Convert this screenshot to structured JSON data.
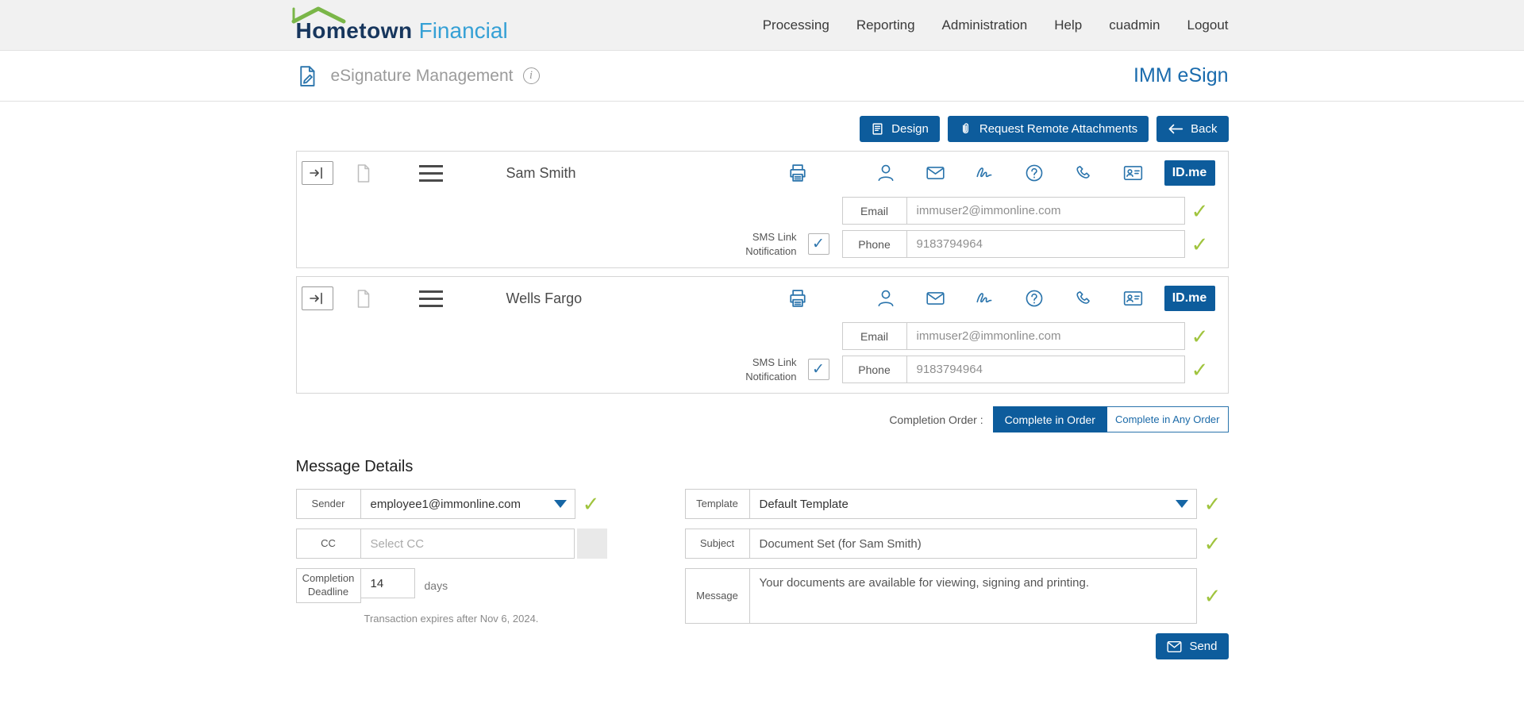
{
  "header": {
    "logo": {
      "name": "Hometown",
      "suffix": "Financial"
    },
    "nav": [
      "Processing",
      "Reporting",
      "Administration",
      "Help",
      "cuadmin",
      "Logout"
    ]
  },
  "subheader": {
    "title": "eSignature Management",
    "brand": "IMM eSign"
  },
  "toolbar": {
    "design": "Design",
    "request_remote": "Request Remote Attachments",
    "back": "Back"
  },
  "signers": [
    {
      "name": "Sam Smith",
      "email_label": "Email",
      "email": "immuser2@immonline.com",
      "sms_label": "SMS Link Notification",
      "phone_label": "Phone",
      "phone": "9183794964",
      "idme": "ID.me"
    },
    {
      "name": "Wells Fargo",
      "email_label": "Email",
      "email": "immuser2@immonline.com",
      "sms_label": "SMS Link Notification",
      "phone_label": "Phone",
      "phone": "9183794964",
      "idme": "ID.me"
    }
  ],
  "completion_order": {
    "label": "Completion Order :",
    "in_order": "Complete in Order",
    "any_order": "Complete in Any Order"
  },
  "message_details": {
    "title": "Message Details",
    "sender_label": "Sender",
    "sender_value": "employee1@immonline.com",
    "cc_label": "CC",
    "cc_placeholder": "Select CC",
    "deadline_label": "Completion Deadline",
    "deadline_value": "14",
    "deadline_units": "days",
    "expires_note": "Transaction expires after Nov 6, 2024.",
    "template_label": "Template",
    "template_value": "Default Template",
    "subject_label": "Subject",
    "subject_value": "Document Set (for Sam Smith)",
    "message_label": "Message",
    "message_value": "Your documents are available for viewing, signing and printing.",
    "send": "Send"
  },
  "icons": {
    "check": "✓",
    "info": "i"
  },
  "colors": {
    "primary_blue": "#0d5c9c",
    "brand_blue": "#1a6bad",
    "icon_blue": "#2a74ac",
    "check_green": "#a0c43e",
    "logo_navy": "#17365d",
    "logo_light_blue": "#35a0d5",
    "roof_green": "#7ab648",
    "topbar_gray": "#f1f1f1"
  }
}
